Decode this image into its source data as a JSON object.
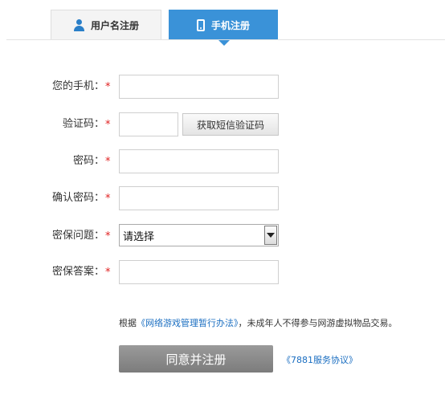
{
  "tabs": {
    "username_label": "用户名注册",
    "phone_label": "手机注册"
  },
  "form": {
    "phone_label": "您的手机：",
    "code_label": "验证码：",
    "sms_button": "获取短信验证码",
    "password_label": "密码：",
    "confirm_label": "确认密码：",
    "question_label": "密保问题：",
    "question_value": "请选择",
    "answer_label": "密保答案：",
    "required_mark": "*"
  },
  "notice": {
    "prefix": "根据",
    "link": "《网络游戏管理暂行办法》",
    "suffix": "，未成年人不得参与网游虚拟物品交易。"
  },
  "submit_label": "同意并注册",
  "agreement_link": "《7881服务协议》",
  "colors": {
    "accent": "#3a92d8",
    "required": "#e02020",
    "link": "#1a6ec1",
    "submit": "#8a8a8a"
  }
}
